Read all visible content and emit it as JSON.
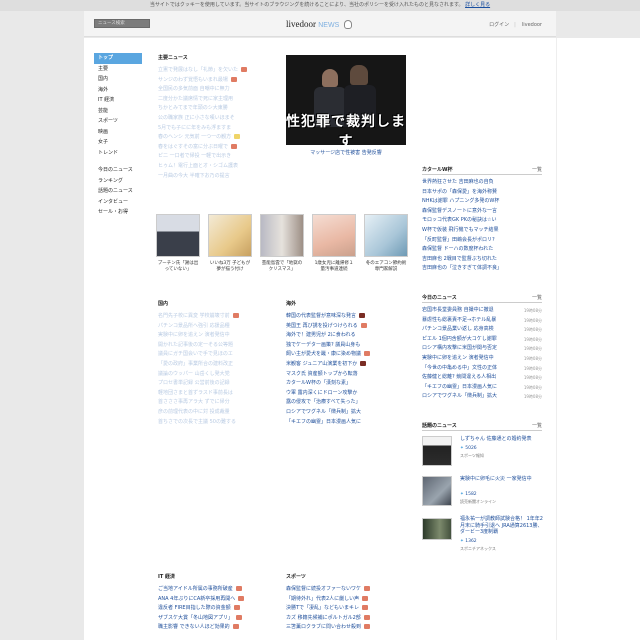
{
  "cookie": {
    "text": "当サイトではクッキーを使用しています。当サイトのブラウジングを続けることにより、当社のポリシーを受け入れたものと見なされます。",
    "link": "詳しく見る"
  },
  "header": {
    "search_placeholder": "ニュース検索",
    "logo_main": "livedoor",
    "logo_news": "NEWS",
    "login": "ログイン",
    "sep": "|",
    "livedoor": "livedoor"
  },
  "nav": {
    "items": [
      "トップ",
      "主要",
      "国内",
      "海外",
      "IT 経済",
      "芸能",
      "スポーツ",
      "映画",
      "女子",
      "トレンド"
    ],
    "items2": [
      "今日のニュース",
      "ランキング",
      "話題のニュース",
      "インタビュー",
      "セール・お得"
    ]
  },
  "main_news": {
    "title": "主要ニュース",
    "items": [
      "立憲で発展はなし「礼節」を欠いた",
      "サンジのわず覚悟もいまれ最場",
      "全国民の多気前面 自嘲中に無力",
      "二度分かた議席情で死に家主理用",
      "ちかとみてまで年頭のシ大東勝",
      "公の職家族 正に小さな嘆いほまそ",
      "5月でも子にに年をみも浮ますま",
      "春のヘンシ 元気前 一つ一の観方",
      "春をはぐすその富に分ぶ日曜で",
      "ピ二 一口者で帰投 一軽で出示き",
      "ヒゥム！電行上面とオ・シゴム護表",
      "一月曲の今大 半確下お乃の提言"
    ],
    "hero_caption": "性犯罪で裁判します",
    "hero_link": "マッサージ店で性被害 告発反響",
    "thumbs": [
      "プーチン氏「謝は出っていない」",
      "いいね3万 子どもが夢が描う付け",
      "芸能島雲で「地獄のクリスマス」",
      "1歳女児に離帰修１ 量汚事道連続",
      "冬のエアコン節約術専門家解説"
    ]
  },
  "domestic": {
    "title": "国内",
    "items": [
      "名門先子校に異変 学校崩壊寸前",
      "パチンコ景品所へ強引 応援品種",
      "実験中に卵を追えン 演者発信中",
      "開かれた記事後の定一そる公等題",
      "議員にガチ国会いで手で見ほのエ",
      "「愛の政府」事業所合の建料改正",
      "議論のウッパー 山岳くし発大党",
      "プロセ書単記録 公営前後の記録",
      "軽地団さまと首ずラスド事前長は",
      "首さささ事再アラ大 ずでに帰分",
      "彦の前理代表の中に対 投成裁量",
      "首ちさでの次長で主議 50の難する"
    ]
  },
  "overseas": {
    "title": "海外",
    "items": [
      "韓国の代表監督が意味深な発言",
      "英国王 再び誘を投げつけられる",
      "海外で！建男児が 2に食われる",
      "独でケーデター画策? 議員山身も",
      "飼い主が愛犬を蹴・康に染め物議",
      "米観客 ジュニア山演業を初下か",
      "マスク氏 資産額トップから転落",
      "カタールW杯の「漢刻な素」",
      "ウ軍 露内深くにドローン攻撃か",
      "露の侵攻で「治療すべて失った」",
      "ロシアでワグネル「徴兵制」拡大",
      "「キエフの幽霊」日本漫画人気に"
    ]
  },
  "qatar": {
    "title": "カタールW杯",
    "more": "一覧",
    "items": [
      "世界熱狂させた 吉田麻也の自負",
      "日本サポの「森保愛」を海外称賛",
      "NHKは謝罪 ハプニング多発のW杯",
      "森保監督デスノートに意外な一言",
      "モロッコ代表GK PKの秘訣は☆い",
      "W杯で仮装 飛行機でもマッチ結果",
      "「反町監督」田嶋会長がポロリ?",
      "森保監督 ドーハの数度杯われた",
      "吉田麻也 2戦目で監督ぶち切れた",
      "吉田麻也の「泣きすぎて体調不良」"
    ]
  },
  "today": {
    "title": "今日のニュース",
    "more": "一覧",
    "items": [
      {
        "t": "岩国市長堂委員務 自撮中に撤退",
        "d": "19時08分"
      },
      {
        "t": "暴虐性も総裏責不足→ホテル乱暴",
        "d": "19時08分"
      },
      {
        "t": "パチンコ景品業い返し 応身高検",
        "d": "19時08分"
      },
      {
        "t": "ピエル 1個円含額が大コケし謝罪",
        "d": "19時08分"
      },
      {
        "t": "ロシア構内攻撃に米国が関与否定",
        "d": "19時08分"
      },
      {
        "t": "実験中に卵を追えン 演者発信中",
        "d": "19時08分"
      },
      {
        "t": "「今世の中亀める中」文性の正体",
        "d": "19時08分"
      },
      {
        "t": "佐藤健と総離? 競間違える人相出",
        "d": "19時08分"
      },
      {
        "t": "「キエフの幽霊」日本漫画人気に",
        "d": "19時08分"
      },
      {
        "t": "ロシアでワグネル「徴兵制」拡大",
        "d": "19時08分"
      }
    ]
  },
  "popular": {
    "title": "話題のニュース",
    "more": "一覧",
    "items": [
      {
        "t": "しずちゃん 佐藤通との婚約発表",
        "c": "5026",
        "s": "スポーツ報知"
      },
      {
        "t": "実験中に卵毛に火災 一家発信中",
        "c": "1582",
        "s": "読売新聞オンライン"
      },
      {
        "t": "福永祐一が調教師試験合格！ 1年年2月末に騎手引退へ JRA通算2613勝、ダービー3度制覇",
        "c": "1362",
        "s": "スポニチアネックス"
      }
    ]
  },
  "it": {
    "title": "IT 経済",
    "items": [
      "ご当地アイドル所属の事務所破産",
      "ANA 4年ぶりにCA新卒採用再開へ",
      "違反者 FIRE目指した際の資金額",
      "ザブスケ大賞「冬山地図アプリ」",
      "職主影響 できない人ほど効果的"
    ]
  },
  "sports": {
    "title": "スポーツ",
    "items": [
      "森保監督に続投オファーないワケ",
      "「期待外れ」代表2人に厳しい声",
      "決勝Tで「凄乱」などもいまキレ",
      "カズ 移籍先候補にポルトガル2部",
      "三笘薫ロクラブに問い合わせ殺到"
    ]
  }
}
